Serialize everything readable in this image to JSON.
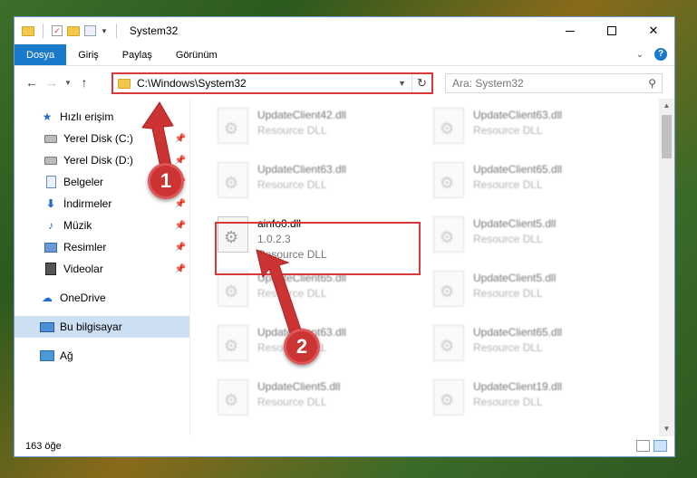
{
  "window": {
    "title": "System32",
    "controls": {
      "minimize": "minimize-icon",
      "maximize": "maximize-icon",
      "close": "✕"
    }
  },
  "ribbon": {
    "tabs": [
      {
        "label": "Dosya",
        "active": true
      },
      {
        "label": "Giriş"
      },
      {
        "label": "Paylaş"
      },
      {
        "label": "Görünüm"
      }
    ],
    "help": "?"
  },
  "navbar": {
    "address": "C:\\Windows\\System32",
    "search_placeholder": "Ara: System32"
  },
  "sidebar": {
    "quick_access": "Hızlı erişim",
    "items": [
      {
        "label": "Yerel Disk (C:)",
        "icon": "drive-icon"
      },
      {
        "label": "Yerel Disk (D:)",
        "icon": "drive-icon"
      },
      {
        "label": "Belgeler",
        "icon": "document-icon"
      },
      {
        "label": "İndirmeler",
        "icon": "download-icon"
      },
      {
        "label": "Müzik",
        "icon": "music-icon"
      },
      {
        "label": "Resimler",
        "icon": "pictures-icon"
      },
      {
        "label": "Videolar",
        "icon": "videos-icon"
      }
    ],
    "onedrive": "OneDrive",
    "this_pc": "Bu bilgisayar",
    "network": "Ağ"
  },
  "files": {
    "left": [
      {
        "name": "UpdateClient42.dll",
        "sub": "Resource DLL"
      },
      {
        "name": "UpdateClient63.dll",
        "sub": "Resource DLL"
      },
      {
        "name": "ainfo0.dll",
        "version": "1.0.2.3",
        "sub": "Resource DLL"
      },
      {
        "name": "UpdateClient65.dll",
        "sub": "Resource DLL"
      },
      {
        "name": "UpdateClient63.dll",
        "sub": "Resource DLL"
      },
      {
        "name": "UpdateClient5.dll",
        "sub": "Resource DLL"
      }
    ],
    "right": [
      {
        "name": "UpdateClient63.dll",
        "sub": "Resource DLL"
      },
      {
        "name": "UpdateClient65.dll",
        "sub": "Resource DLL"
      },
      {
        "name": "UpdateClient5.dll",
        "sub": "Resource DLL"
      },
      {
        "name": "UpdateClient5.dll",
        "sub": "Resource DLL"
      },
      {
        "name": "UpdateClient65.dll",
        "sub": "Resource DLL"
      },
      {
        "name": "UpdateClient19.dll",
        "sub": "Resource DLL"
      }
    ]
  },
  "status": {
    "count": "163 öğe"
  },
  "annotations": {
    "badge1": "1",
    "badge2": "2",
    "accent": "#cc3333"
  }
}
